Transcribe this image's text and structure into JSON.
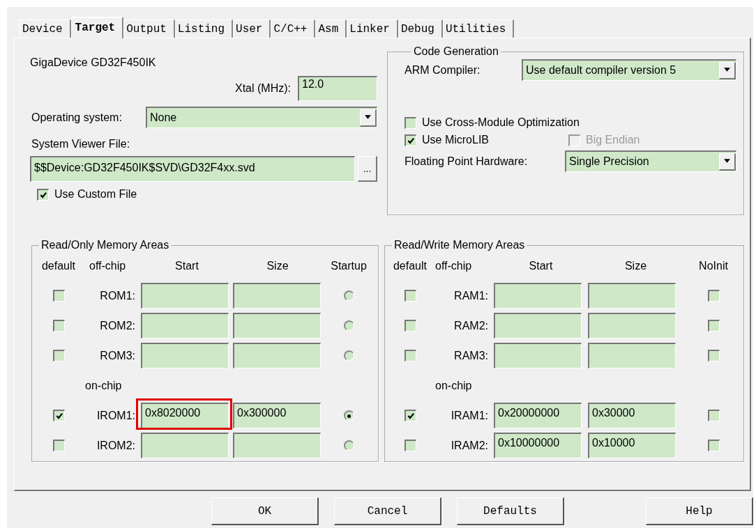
{
  "tabs": [
    {
      "label": "Device",
      "selected": false
    },
    {
      "label": "Target",
      "selected": true
    },
    {
      "label": "Output",
      "selected": false
    },
    {
      "label": "Listing",
      "selected": false
    },
    {
      "label": "User",
      "selected": false
    },
    {
      "label": "C/C++",
      "selected": false
    },
    {
      "label": "Asm",
      "selected": false
    },
    {
      "label": "Linker",
      "selected": false
    },
    {
      "label": "Debug",
      "selected": false
    },
    {
      "label": "Utilities",
      "selected": false
    }
  ],
  "device": "GigaDevice GD32F450IK",
  "xtal": {
    "label": "Xtal (MHz):",
    "value": "12.0"
  },
  "operating_system": {
    "label": "Operating system:",
    "value": "None"
  },
  "system_viewer_file": {
    "label": "System Viewer File:",
    "value": "$$Device:GD32F450IK$SVD\\GD32F4xx.svd",
    "browse": "..."
  },
  "use_custom_file": {
    "label": "Use Custom File",
    "checked": true
  },
  "code_generation": {
    "title": "Code Generation",
    "compiler_label": "ARM Compiler:",
    "compiler_value": "Use default compiler version 5",
    "cross_module": {
      "label": "Use Cross-Module Optimization",
      "checked": false
    },
    "microlib": {
      "label": "Use MicroLIB",
      "checked": true
    },
    "big_endian": {
      "label": "Big Endian",
      "checked": false,
      "disabled": true
    },
    "fpu_label": "Floating Point Hardware:",
    "fpu_value": "Single Precision"
  },
  "memory_groups": [
    {
      "title": "Read/Only Memory Areas",
      "kind": "radio",
      "columns": [
        "default",
        "off-chip",
        "Start",
        "Size",
        "Startup"
      ],
      "on_chip_label": "on-chip",
      "off_chip_rows": [
        {
          "label": "ROM1:",
          "default": false,
          "option": false,
          "highlight": false
        },
        {
          "label": "ROM2:",
          "default": false,
          "option": false,
          "highlight": false
        },
        {
          "label": "ROM3:",
          "default": false,
          "option": false,
          "highlight": false
        }
      ],
      "on_chip_rows": [
        {
          "label": "IROM1:",
          "default": true,
          "start": "0x8020000",
          "size": "0x300000",
          "option": true,
          "highlight": true
        },
        {
          "label": "IROM2:",
          "default": false,
          "option": false,
          "highlight": false
        }
      ]
    },
    {
      "title": "Read/Write Memory Areas",
      "kind": "checkbox",
      "columns": [
        "default",
        "off-chip",
        "Start",
        "Size",
        "NoInit"
      ],
      "on_chip_label": "on-chip",
      "off_chip_rows": [
        {
          "label": "RAM1:",
          "default": false,
          "option": false,
          "highlight": false
        },
        {
          "label": "RAM2:",
          "default": false,
          "option": false,
          "highlight": false
        },
        {
          "label": "RAM3:",
          "default": false,
          "option": false,
          "highlight": false
        }
      ],
      "on_chip_rows": [
        {
          "label": "IRAM1:",
          "default": true,
          "start": "0x20000000",
          "size": "0x30000",
          "option": false,
          "highlight": false
        },
        {
          "label": "IRAM2:",
          "default": false,
          "start": "0x10000000",
          "size": "0x10000",
          "option": false,
          "highlight": false
        }
      ]
    }
  ],
  "buttons": [
    "OK",
    "Cancel",
    "Defaults",
    "Help"
  ]
}
